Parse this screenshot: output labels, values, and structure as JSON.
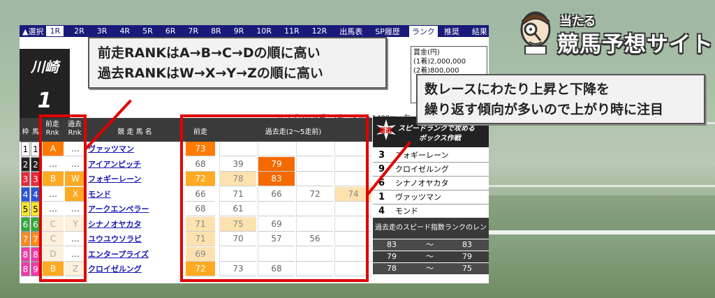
{
  "nav": {
    "items": [
      "▲選択",
      "1R",
      "2R",
      "3R",
      "4R",
      "5R",
      "6R",
      "7R",
      "8R",
      "9R",
      "10R",
      "11R",
      "12R",
      "出馬表",
      "SP履歴",
      "ランク",
      "推奨",
      "結果"
    ],
    "selected_index": 1,
    "active_index": 15
  },
  "venue": {
    "name": "川崎",
    "race": "1"
  },
  "race_info": "サラブレッド系　2歳　ダート1400m　左",
  "prize": {
    "title": "賞金(円)",
    "lines": [
      "(1着)2,000,000",
      "(2着)800,000"
    ]
  },
  "table": {
    "headers": {
      "waku": "枠",
      "umaban": "馬",
      "prev_rank": "前走\nRnk",
      "past_rank": "過去\nRnk",
      "horse": "競 走 馬 名",
      "prev": "前走",
      "past": "過去走(2〜5走前)"
    },
    "rows": [
      {
        "waku": "1",
        "num": "1",
        "prev_rank": "A",
        "past_rank": "…",
        "horse": "ヴァッツマン",
        "prev": "73",
        "past": [
          "",
          "",
          "",
          ""
        ]
      },
      {
        "waku": "2",
        "num": "2",
        "prev_rank": "…",
        "past_rank": "…",
        "horse": "アイアンピッチ",
        "prev": "68",
        "past": [
          "39",
          "79",
          "",
          ""
        ]
      },
      {
        "waku": "3",
        "num": "3",
        "prev_rank": "B",
        "past_rank": "W",
        "horse": "フォギーレーン",
        "prev": "72",
        "past": [
          "78",
          "83",
          "",
          ""
        ]
      },
      {
        "waku": "4",
        "num": "4",
        "prev_rank": "…",
        "past_rank": "X",
        "horse": "モンド",
        "prev": "66",
        "past": [
          "71",
          "66",
          "72",
          "74"
        ]
      },
      {
        "waku": "5",
        "num": "5",
        "prev_rank": "…",
        "past_rank": "…",
        "horse": "アークエンペラー",
        "prev": "68",
        "past": [
          "61",
          "",
          "",
          ""
        ]
      },
      {
        "waku": "6",
        "num": "6",
        "prev_rank": "C",
        "past_rank": "Y",
        "horse": "シナノオヤカタ",
        "prev": "71",
        "past": [
          "75",
          "69",
          "",
          ""
        ]
      },
      {
        "waku": "7",
        "num": "7",
        "prev_rank": "C",
        "past_rank": "…",
        "horse": "ユウユウソラビ",
        "prev": "71",
        "past": [
          "70",
          "57",
          "56",
          ""
        ]
      },
      {
        "waku": "8",
        "num": "8",
        "prev_rank": "D",
        "past_rank": "…",
        "horse": "エンタープライズ",
        "prev": "69",
        "past": [
          "",
          "",
          "",
          ""
        ]
      },
      {
        "waku": "8",
        "num": "9",
        "prev_rank": "B",
        "past_rank": "Z",
        "horse": "クロイゼルング",
        "prev": "72",
        "past": [
          "73",
          "68",
          "",
          ""
        ]
      }
    ]
  },
  "callouts": {
    "rank_order_1": "前走RANKはA→B→C→Dの順に高い",
    "rank_order_2": "過去RANKはW→X→Y→Zの順に高い",
    "trend_1": "数レースにわたり上昇と下降を",
    "trend_2": "繰り返す傾向が多いので上がり時に注目"
  },
  "speed_box": {
    "badge": "厳選",
    "title_1": "スピードランクで攻める",
    "title_2": "ボックス作戦",
    "entries": [
      {
        "num": "3",
        "name": "フォギーレーン"
      },
      {
        "num": "9",
        "name": "クロイゼルング"
      },
      {
        "num": "6",
        "name": "シナノオヤカタ"
      },
      {
        "num": "1",
        "name": "ヴァッツマン"
      },
      {
        "num": "4",
        "name": "モンド"
      }
    ],
    "range_title": "過去走のスピード指数ランクのレンジ",
    "ranges": [
      {
        "low": "83",
        "sep": "〜",
        "high": "83"
      },
      {
        "low": "79",
        "sep": "〜",
        "high": "79"
      },
      {
        "low": "78",
        "sep": "〜",
        "high": "75"
      }
    ]
  },
  "logo": {
    "small": "当たる",
    "big": "競馬予想サイト"
  },
  "colors": {
    "nav_bg": "#1a1a7a",
    "highlight_red": "#e00000",
    "rank_a": "#ff7a00",
    "rank_b": "#ffaa22",
    "rank_c": "#fde2b0",
    "waku": [
      "#ffffff",
      "#222222",
      "#e8283a",
      "#2a55d8",
      "#f5e62b",
      "#2faa3a",
      "#ff8a1a",
      "#ee3aa8"
    ]
  }
}
